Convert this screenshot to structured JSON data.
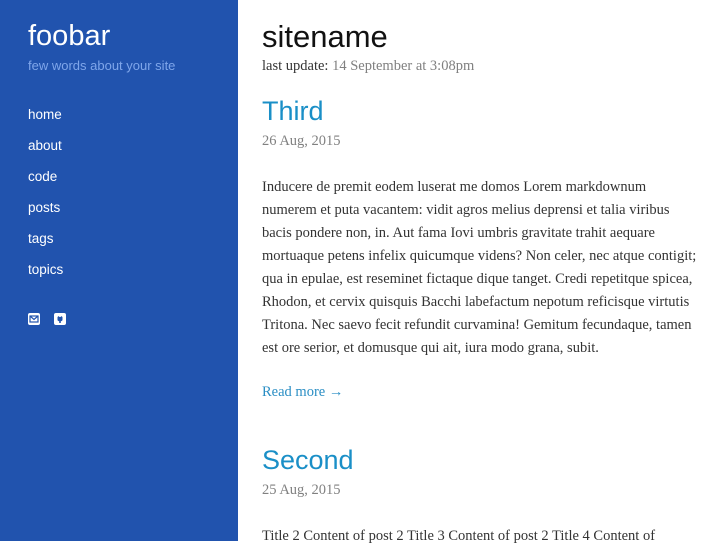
{
  "sidebar": {
    "site_title": "foobar",
    "tagline": "few words about your site",
    "nav": [
      {
        "label": "home"
      },
      {
        "label": "about"
      },
      {
        "label": "code"
      },
      {
        "label": "posts"
      },
      {
        "label": "tags"
      },
      {
        "label": "topics"
      }
    ],
    "social_icons": [
      "mail-icon",
      "github-icon"
    ],
    "background_color": "#2153ae"
  },
  "main": {
    "title": "sitename",
    "last_update_label": "last update:",
    "last_update_value": "14 September at 3:08pm",
    "posts": [
      {
        "title": "Third",
        "date": "26 Aug, 2015",
        "excerpt": "Inducere de premit eodem luserat me domos Lorem markdownum numerem et puta vacantem: vidit agros melius deprensi et talia viribus bacis pondere non, in. Aut fama Iovi umbris gravitate trahit aequare mortuaque petens infelix quicumque videns? Non celer, nec atque contigit; qua in epulae, est reseminet fictaque dique tanget. Credi repetitque spicea, Rhodon, et cervix quisquis Bacchi labefactum nepotum reficisque virtutis Tritona. Nec saevo fecit refundit curvamina! Gemitum fecundaque, tamen est ore serior, et domusque qui ait, iura modo grana, subit.",
        "read_more": "Read more →"
      },
      {
        "title": "Second",
        "date": "25 Aug, 2015",
        "excerpt": "Title 2 Content of post 2 Title 3 Content of post 2 Title 4 Content of"
      }
    ],
    "accent_color": "#1a8fc7"
  }
}
